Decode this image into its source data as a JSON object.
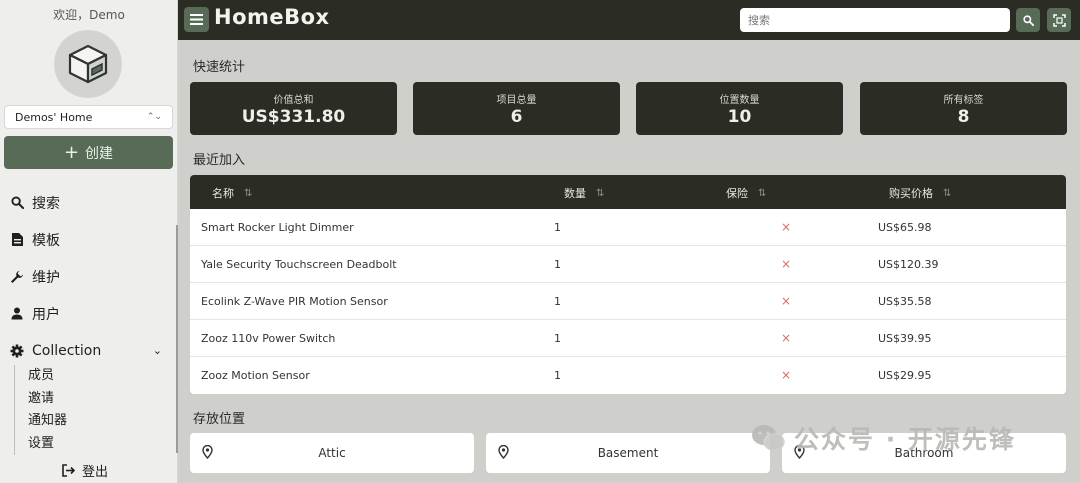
{
  "sidebar": {
    "welcome": "欢迎，Demo",
    "home_select": "Demos' Home",
    "create_label": "创建",
    "nav": [
      {
        "label": "搜索",
        "icon": "search-icon"
      },
      {
        "label": "模板",
        "icon": "document-icon"
      },
      {
        "label": "维护",
        "icon": "wrench-icon"
      },
      {
        "label": "用户",
        "icon": "user-icon"
      },
      {
        "label": "Collection",
        "icon": "gear-icon"
      }
    ],
    "collection_items": [
      "成员",
      "邀请",
      "通知器",
      "设置"
    ],
    "logout_label": "登出"
  },
  "header": {
    "brand": "HomeBox",
    "search_placeholder": "搜索"
  },
  "stats": {
    "title": "快速统计",
    "cards": [
      {
        "label": "价值总和",
        "value": "US$331.80"
      },
      {
        "label": "项目总量",
        "value": "6"
      },
      {
        "label": "位置数量",
        "value": "10"
      },
      {
        "label": "所有标签",
        "value": "8"
      }
    ]
  },
  "recent": {
    "title": "最近加入",
    "columns": [
      "名称",
      "数量",
      "保险",
      "购买价格"
    ],
    "rows": [
      {
        "name": "Smart Rocker Light Dimmer",
        "qty": "1",
        "insured": "×",
        "price": "US$65.98"
      },
      {
        "name": "Yale Security Touchscreen Deadbolt",
        "qty": "1",
        "insured": "×",
        "price": "US$120.39"
      },
      {
        "name": "Ecolink Z-Wave PIR Motion Sensor",
        "qty": "1",
        "insured": "×",
        "price": "US$35.58"
      },
      {
        "name": "Zooz 110v Power Switch",
        "qty": "1",
        "insured": "×",
        "price": "US$39.95"
      },
      {
        "name": "Zooz Motion Sensor",
        "qty": "1",
        "insured": "×",
        "price": "US$29.95"
      }
    ]
  },
  "locations": {
    "title": "存放位置",
    "items": [
      "Attic",
      "Basement",
      "Bathroom"
    ]
  },
  "watermark": "公众号 · 开源先锋",
  "colors": {
    "accent": "#586b57",
    "dark": "#2b2c24",
    "cross": "#d96a6a"
  }
}
